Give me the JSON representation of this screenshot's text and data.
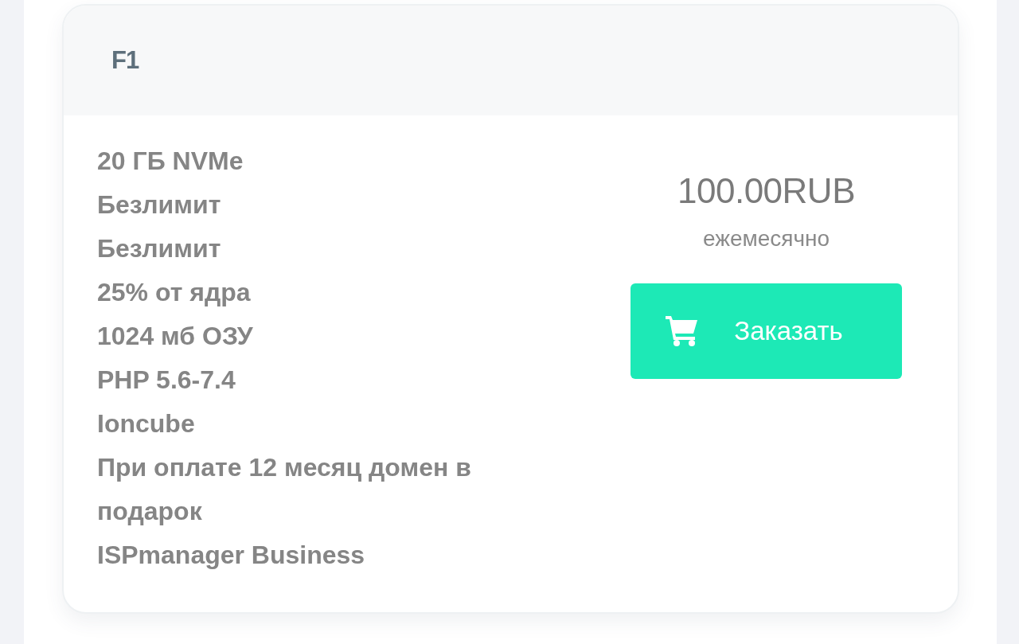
{
  "plan": {
    "title": "F1",
    "features": [
      "20 ГБ NVMe",
      "Безлимит",
      "Безлимит",
      "25% от ядра",
      "1024 мб ОЗУ",
      "PHP 5.6-7.4",
      "Ioncube",
      "При оплате 12 месяц домен в подарок",
      "ISPmanager Business"
    ],
    "price": "100.00RUB",
    "period": "ежемесячно",
    "order_button": {
      "label": "Заказать"
    }
  }
}
